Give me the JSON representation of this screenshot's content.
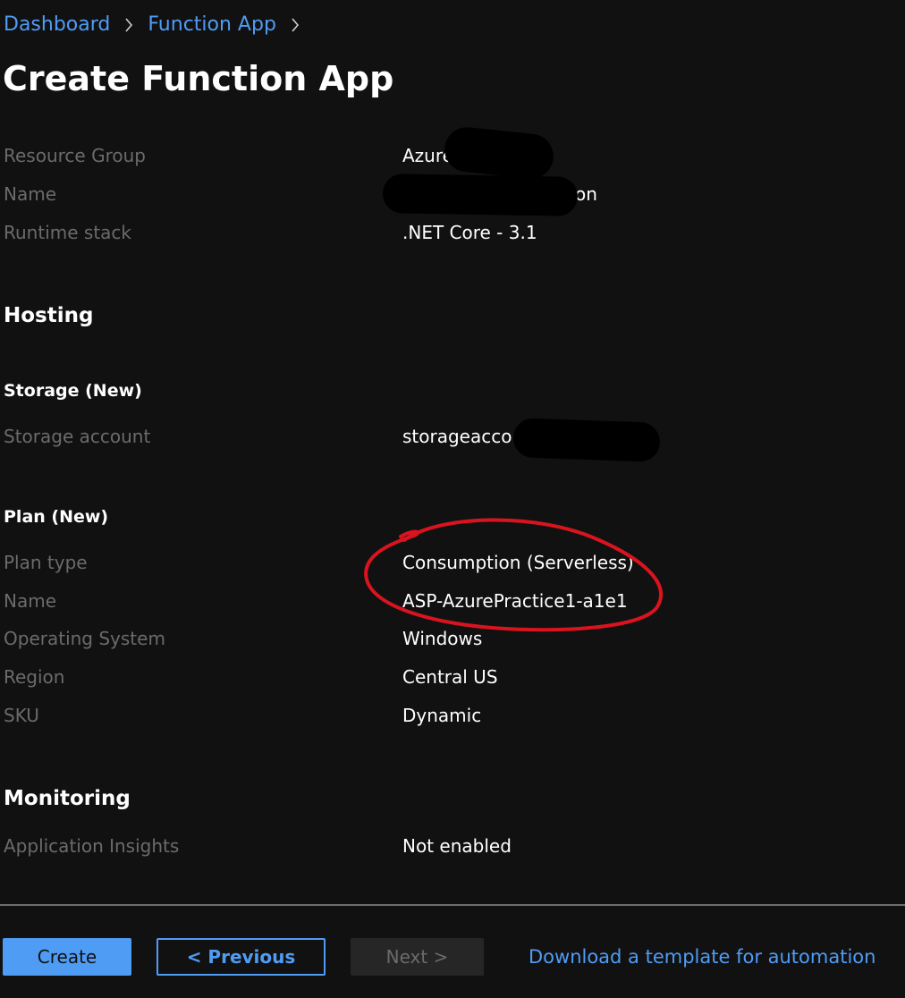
{
  "breadcrumb": {
    "items": [
      "Dashboard",
      "Function App"
    ]
  },
  "page": {
    "title": "Create Function App"
  },
  "basics": {
    "resource_group_label": "Resource Group",
    "resource_group_value": "Azure",
    "name_label": "Name",
    "name_value": "on",
    "runtime_label": "Runtime stack",
    "runtime_value": ".NET Core - 3.1"
  },
  "hosting": {
    "heading": "Hosting",
    "storage_heading": "Storage (New)",
    "storage_account_label": "Storage account",
    "storage_account_value": "storageacco",
    "plan_heading": "Plan (New)",
    "plan_type_label": "Plan type",
    "plan_type_value": "Consumption (Serverless)",
    "plan_name_label": "Name",
    "plan_name_value": "ASP-AzurePractice1-a1e1",
    "os_label": "Operating System",
    "os_value": "Windows",
    "region_label": "Region",
    "region_value": "Central US",
    "sku_label": "SKU",
    "sku_value": "Dynamic"
  },
  "monitoring": {
    "heading": "Monitoring",
    "insights_label": "Application Insights",
    "insights_value": "Not enabled"
  },
  "footer": {
    "create_label": "Create",
    "previous_label": "< Previous",
    "next_label": "Next >",
    "template_link": "Download a template for automation"
  },
  "colors": {
    "background": "#111111",
    "accent": "#4f9cf5",
    "label": "#6b6b6b",
    "annotation": "#d9141e",
    "redaction": "#000000"
  },
  "icons": {
    "breadcrumb_separator": "chevron-right-icon"
  }
}
